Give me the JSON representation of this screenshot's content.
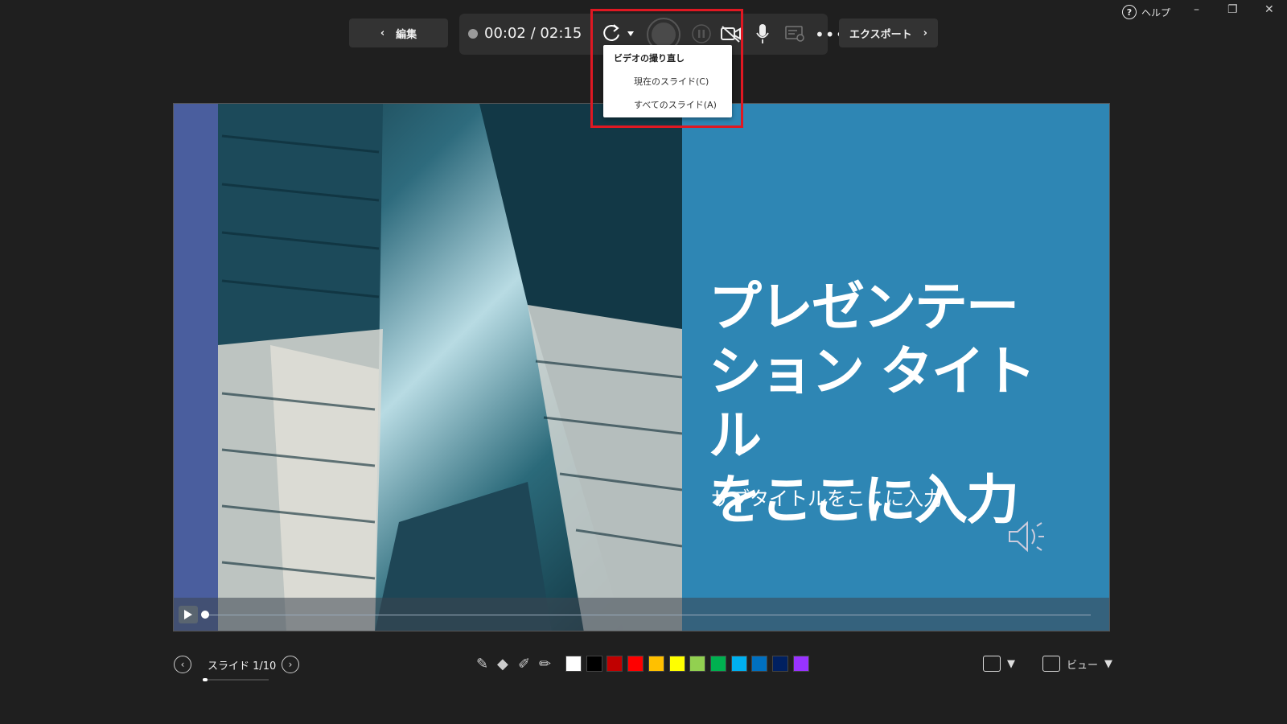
{
  "top_bar": {
    "help_label": "ヘルプ",
    "edit_label": "編集",
    "time_current": "00:02",
    "time_separator": "/",
    "time_total": "02:15",
    "export_label": "エクスポート"
  },
  "retake_menu": {
    "title": "ビデオの撮り直し",
    "items": [
      "現在のスライド(C)",
      "すべてのスライド(A)"
    ]
  },
  "slide": {
    "title_lines": [
      "プレゼンテー",
      "ション タイトル",
      "をここに入力"
    ],
    "subtitle": "サブタイトルをここに入力"
  },
  "bottom_bar": {
    "slide_counter": "スライド 1/10",
    "view_label": "ビュー",
    "colors": [
      "#ffffff",
      "#000000",
      "#c00000",
      "#ff0000",
      "#ffc000",
      "#ffff00",
      "#92d050",
      "#00b050",
      "#00b0f0",
      "#0070c0",
      "#002060",
      "#9933ff"
    ]
  },
  "icons": [
    "help-icon",
    "back-chevron-icon",
    "retake-icon",
    "record-icon",
    "pause-icon",
    "camera-off-icon",
    "mic-icon",
    "teleprompter-icon",
    "more-icon",
    "forward-chevron-icon",
    "speaker-icon",
    "play-icon",
    "prev-slide-icon",
    "next-slide-icon",
    "pen-icon",
    "eraser-icon",
    "highlighter-icon",
    "camera-layout-icon",
    "view-icon"
  ],
  "accent_colors": {
    "slide_bg": "#2e86b4",
    "highlight_box": "#e01822",
    "left_strip": "#4a5e9e"
  }
}
